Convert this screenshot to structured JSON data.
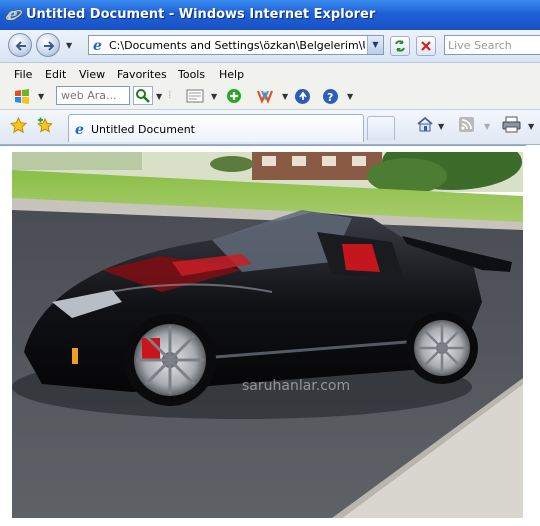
{
  "window": {
    "title": "Untitled Document - Windows Internet Explorer"
  },
  "address_bar": {
    "url": "C:\\Documents and Settings\\özkan\\Belgelerim\\Untitled"
  },
  "search": {
    "placeholder": "Live Search"
  },
  "menu": {
    "items": [
      "File",
      "Edit",
      "View",
      "Favorites",
      "Tools",
      "Help"
    ]
  },
  "toolbar": {
    "web_search_placeholder": "web Ara..."
  },
  "tabs": [
    {
      "label": "Untitled Document"
    }
  ],
  "photo": {
    "watermark": "saruhanlar.com"
  },
  "colors": {
    "titlebar": "#1f5fd6",
    "menubar": "#f1f1ed",
    "accent_red": "#cc1a1a"
  },
  "icons": [
    "ie-icon",
    "back-arrow-icon",
    "forward-arrow-icon",
    "refresh-icon",
    "stop-icon",
    "windows-flag-icon",
    "magnifier-icon",
    "page-icon",
    "add-icon",
    "messenger-icon",
    "info-icon",
    "help-icon",
    "star-icon",
    "add-favorite-icon",
    "home-icon",
    "rss-icon",
    "print-icon"
  ]
}
